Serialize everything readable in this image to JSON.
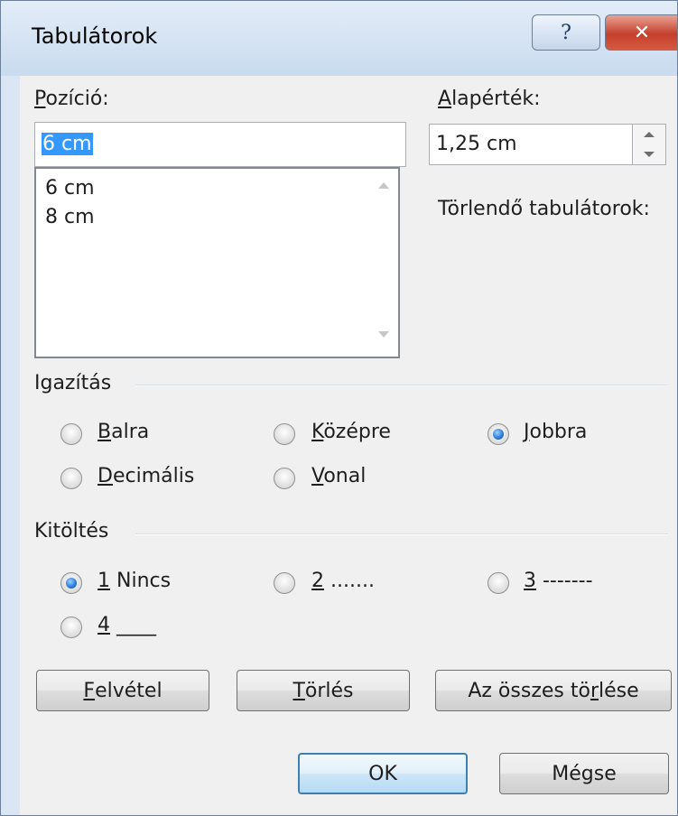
{
  "window": {
    "title": "Tabulátorok",
    "help_glyph": "?",
    "close_glyph": "✕"
  },
  "position": {
    "label_first": "P",
    "label_rest": "ozíció:",
    "value": "6 cm",
    "list": [
      "6 cm",
      "8 cm"
    ]
  },
  "default_tab": {
    "label_first": "A",
    "label_rest": "lapérték:",
    "value": "1,25 cm"
  },
  "clear_label": "Törlendő tabulátorok:",
  "alignment": {
    "title": "Igazítás",
    "options": [
      {
        "key": "B",
        "rest": "alra",
        "checked": false
      },
      {
        "key": "K",
        "rest": "özépre",
        "checked": false
      },
      {
        "key": "J",
        "rest": "obbra",
        "checked": true
      },
      {
        "key": "D",
        "rest": "ecimális",
        "checked": false
      },
      {
        "key": "V",
        "rest": "onal",
        "checked": false
      }
    ]
  },
  "leader": {
    "title": "Kitöltés",
    "options": [
      {
        "key": "1",
        "rest": " Nincs",
        "checked": true
      },
      {
        "key": "2",
        "rest": " .......",
        "checked": false
      },
      {
        "key": "3",
        "rest": " -------",
        "checked": false
      },
      {
        "key": "4",
        "rest": " ____",
        "checked": false
      }
    ]
  },
  "buttons": {
    "set_key": "F",
    "set_rest": "elvétel",
    "clear_key": "T",
    "clear_rest": "örlés",
    "clear_all_pre": "Az összes tö",
    "clear_all_key": "r",
    "clear_all_post": "lése",
    "ok": "OK",
    "cancel": "Mégse"
  },
  "colors": {
    "selection": "#3399ff",
    "radio_checked": "#2777d8",
    "close_button": "#c4402c"
  }
}
